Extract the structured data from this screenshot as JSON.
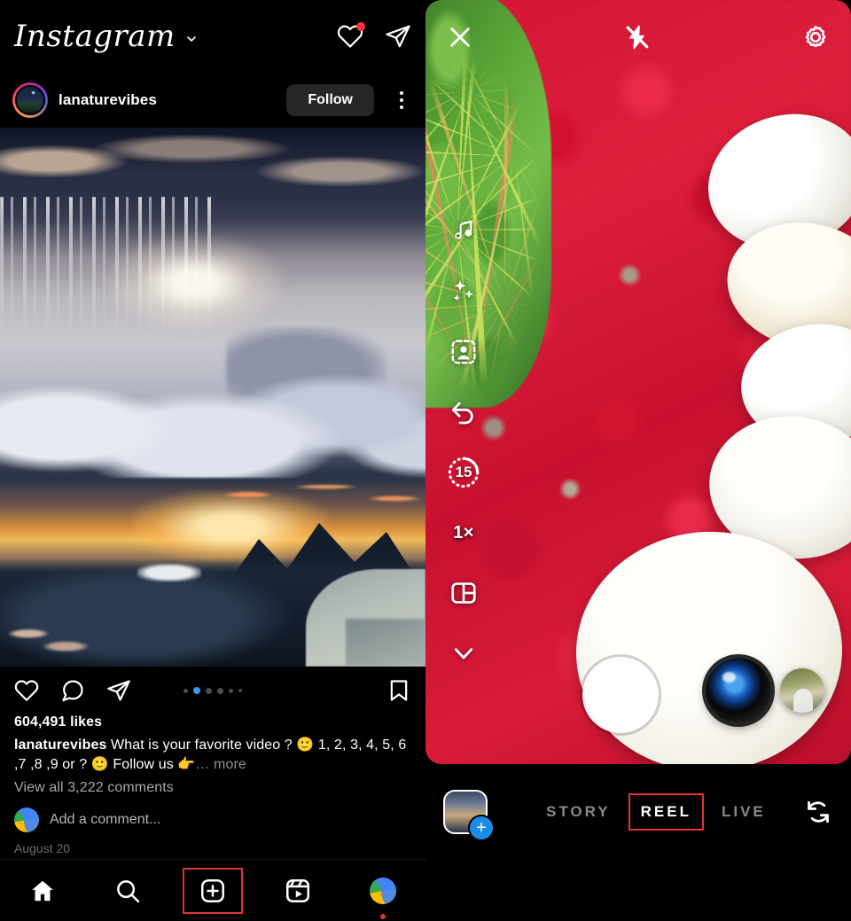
{
  "feed": {
    "header": {
      "logo": "Instagram",
      "chevron_icon": "chevron-down-icon",
      "activity_icon": "heart-icon",
      "messages_icon": "direct-message-icon",
      "has_activity_badge": true
    },
    "post": {
      "username": "lanaturevibes",
      "follow_label": "Follow",
      "options_icon": "more-options-icon",
      "likes": "604,491 likes",
      "caption_author": "lanaturevibes",
      "caption_text": " What is your favorite video ? 🙂 1, 2, 3, 4, 5, 6 ,7 ,8 ,9 or ? 🙂 Follow us 👉",
      "caption_more": "… more",
      "view_comments": "View all 3,222 comments",
      "add_comment_placeholder": "Add a comment...",
      "post_date": "August 20",
      "carousel": {
        "count": 6,
        "active_index": 1
      },
      "actions": {
        "like_icon": "heart-icon",
        "comment_icon": "comment-bubble-icon",
        "share_icon": "share-paperplane-icon",
        "save_icon": "bookmark-icon"
      }
    },
    "bottom_nav": [
      {
        "name": "home",
        "icon": "home-icon",
        "highlighted": false
      },
      {
        "name": "search",
        "icon": "search-icon",
        "highlighted": false
      },
      {
        "name": "create",
        "icon": "plus-square-icon",
        "highlighted": true
      },
      {
        "name": "reels",
        "icon": "reels-icon",
        "highlighted": false
      },
      {
        "name": "profile",
        "icon": "profile-avatar-icon",
        "highlighted": false
      }
    ]
  },
  "camera": {
    "top": {
      "close_icon": "close-x-icon",
      "flash_icon": "flash-off-icon",
      "settings_icon": "gear-icon"
    },
    "tools": [
      {
        "name": "audio",
        "icon": "music-note-icon",
        "label": ""
      },
      {
        "name": "effects",
        "icon": "sparkles-icon",
        "label": ""
      },
      {
        "name": "green-screen",
        "icon": "person-frame-icon",
        "label": ""
      },
      {
        "name": "undo",
        "icon": "undo-arrow-icon",
        "label": ""
      },
      {
        "name": "timer",
        "icon": "timer-icon",
        "label": "15"
      },
      {
        "name": "speed",
        "icon": "speed-icon",
        "label": "1×"
      },
      {
        "name": "layout",
        "icon": "layout-grid-icon",
        "label": ""
      },
      {
        "name": "more",
        "icon": "chevron-down-icon",
        "label": ""
      }
    ],
    "shutter": {
      "name": "shutter-button"
    },
    "bottom": {
      "gallery_icon": "gallery-thumbnail-icon",
      "gallery_add_label": "+",
      "modes": [
        {
          "label": "STORY",
          "active": false,
          "highlighted": false
        },
        {
          "label": "REEL",
          "active": true,
          "highlighted": true
        },
        {
          "label": "LIVE",
          "active": false,
          "highlighted": false
        }
      ],
      "flip_icon": "flip-camera-icon"
    }
  },
  "colors": {
    "accent_blue": "#3897f0",
    "highlight_red": "#e03434",
    "notification_red": "#ff3040",
    "follow_bg": "#262626",
    "muted_text": "#a8a8a8"
  }
}
